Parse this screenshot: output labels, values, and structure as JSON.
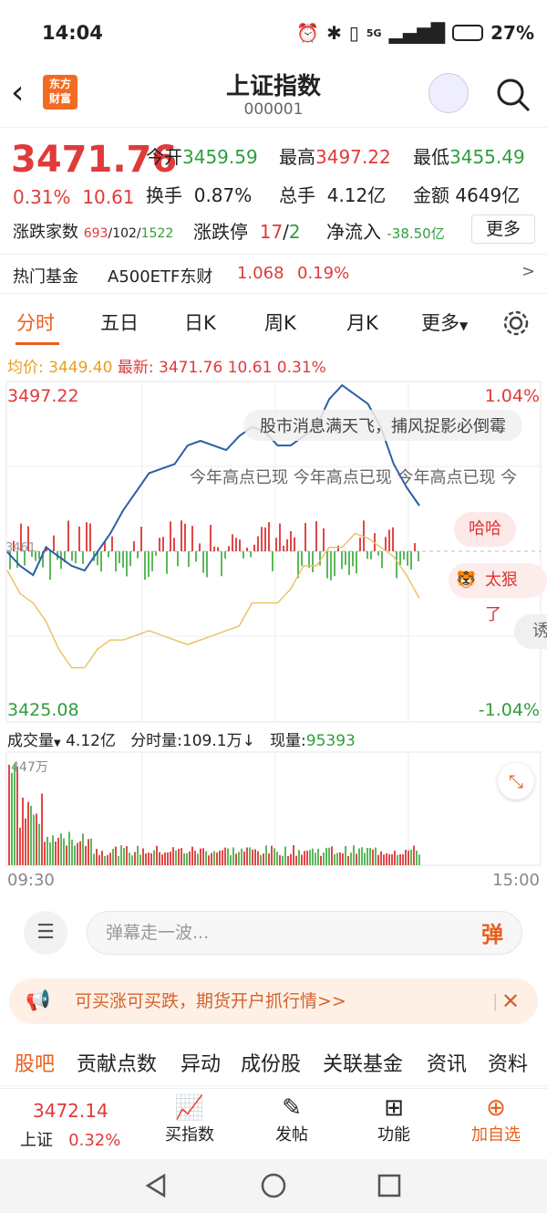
{
  "status": {
    "time": "14:04",
    "network": "5G",
    "battery": "27%"
  },
  "header": {
    "logo_text1": "东方",
    "logo_text2": "财富",
    "title": "上证指数",
    "code": "000001"
  },
  "quote": {
    "price": "3471.76",
    "change_pct": "0.31%",
    "change_abs": "10.61",
    "open_label": "今开",
    "open": "3459.59",
    "high_label": "最高",
    "high": "3497.22",
    "low_label": "最低",
    "low": "3455.49",
    "turnover_label": "换手",
    "turnover": "0.87%",
    "volume_label": "总手",
    "volume": "4.12亿",
    "amount_label": "金额",
    "amount": "4649亿",
    "advdec_label": "涨跌家数",
    "adv": "693",
    "flat": "102",
    "dec": "1522",
    "limit_label": "涨跌停",
    "limit_up": "17",
    "limit_down": "2",
    "inflow_label": "净流入",
    "inflow": "-38.50亿",
    "more": "更多"
  },
  "hotfund": {
    "label": "热门基金",
    "name": "A500ETF东财",
    "price": "1.068",
    "pct": "0.19%"
  },
  "tabs": [
    "分时",
    "五日",
    "日K",
    "周K",
    "月K",
    "更多"
  ],
  "avgline": {
    "avg_label": "均价:",
    "avg": "3449.40",
    "latest_label": "最新:",
    "latest": "3471.76",
    "chg": "10.61",
    "pct": "0.31%"
  },
  "chart_axis": {
    "top_price": "3497.22",
    "bottom_price": "3425.08",
    "top_pct": "1.04%",
    "bottom_pct": "-1.04%",
    "mid_price": "3461"
  },
  "danmu": {
    "d1": "股市消息满天飞，捕风捉影必倒霉",
    "d2": "今年高点已现 今年高点已现 今年高点已现 今",
    "d3": "哈哈",
    "d4": "太狠了",
    "d5": "诱"
  },
  "volinfo": {
    "label": "成交量",
    "total": "4.12亿",
    "minute": "分时量:109.1万",
    "current_label": "现量:",
    "current": "95393",
    "max": "447万"
  },
  "time_axis": {
    "start": "09:30",
    "end": "15:00"
  },
  "comment": {
    "placeholder": "弹幕走一波...",
    "send": "弹"
  },
  "ad": {
    "text": "可买涨可买跌，期货开户抓行情>>"
  },
  "bottomtabs": [
    "股吧",
    "贡献点数",
    "异动",
    "成份股",
    "关联基金",
    "资讯",
    "资料"
  ],
  "bottombar": {
    "price": "3472.14",
    "name": "上证",
    "pct": "0.32%",
    "b1": "买指数",
    "b2": "发帖",
    "b3": "功能",
    "b4": "加自选"
  },
  "chart_data": {
    "type": "line",
    "x": [
      "09:30",
      "15:00"
    ],
    "price_range": [
      3425.08,
      3497.22
    ],
    "series": [
      {
        "name": "最新",
        "values": [
          3461,
          3458,
          3456,
          3462,
          3460,
          3458,
          3457,
          3461,
          3465,
          3470,
          3474,
          3478,
          3479,
          3480,
          3484,
          3485,
          3484,
          3483,
          3486,
          3488,
          3487,
          3484,
          3484,
          3486,
          3488,
          3494,
          3497,
          3495,
          3493,
          3488,
          3480,
          3475,
          3471
        ]
      },
      {
        "name": "均价",
        "values": [
          3457,
          3452,
          3450,
          3446,
          3440,
          3436,
          3436,
          3440,
          3442,
          3442,
          3443,
          3444,
          3443,
          3442,
          3441,
          3442,
          3443,
          3444,
          3445,
          3450,
          3450,
          3450,
          3453,
          3458,
          3458,
          3462,
          3462,
          3465,
          3464,
          3462,
          3460,
          3456,
          3451
        ]
      }
    ]
  }
}
